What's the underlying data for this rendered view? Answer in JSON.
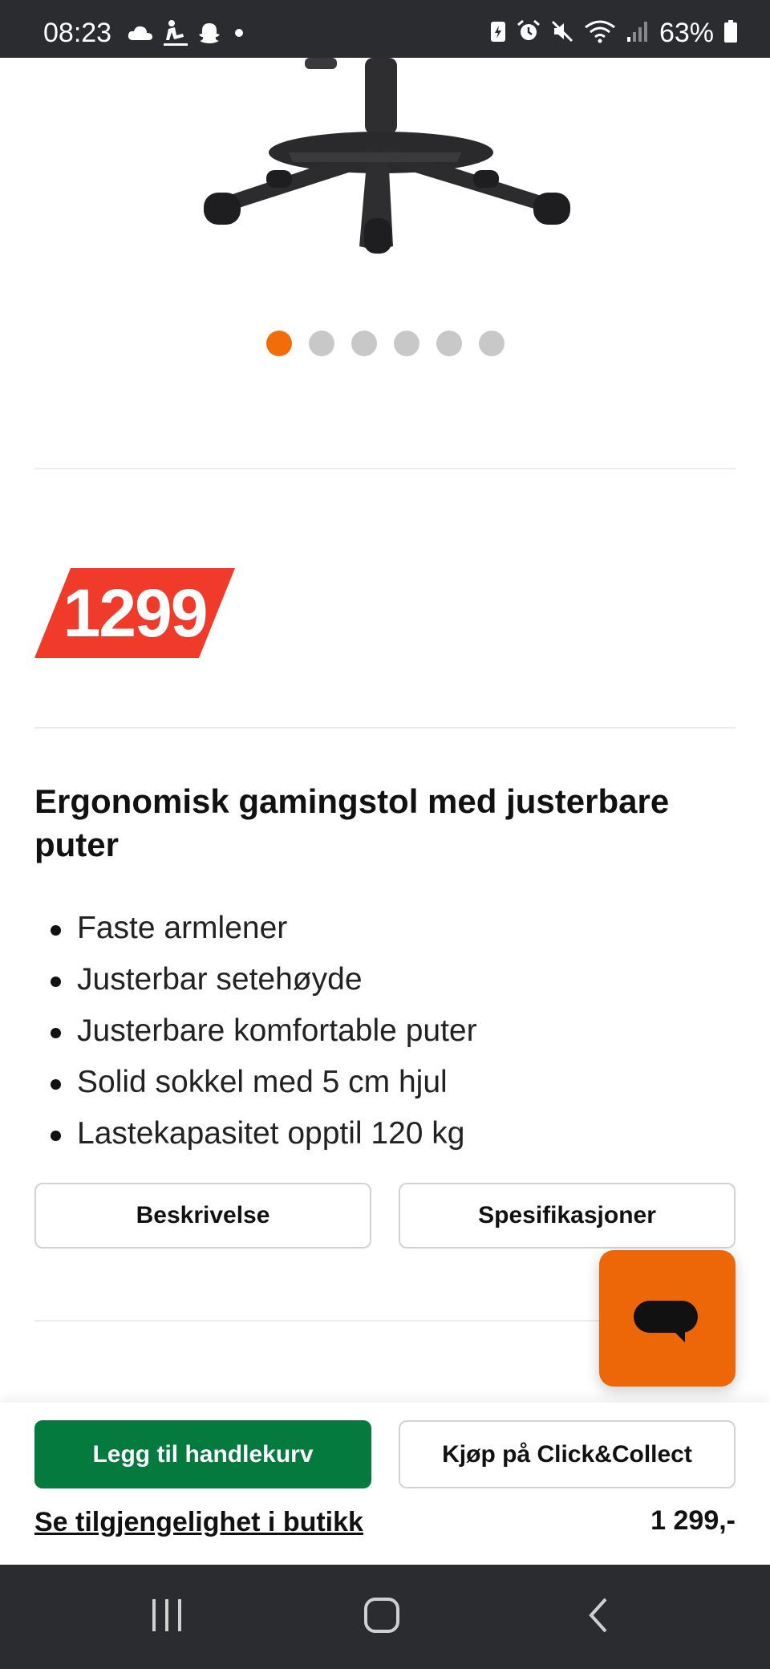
{
  "status_bar": {
    "time": "08:23",
    "battery": "63%",
    "left_icons": [
      "cloud-icon",
      "figure-icon",
      "snapchat-icon",
      "dot-icon"
    ],
    "right_icons": [
      "battery-saver-icon",
      "alarm-icon",
      "mute-icon",
      "wifi-icon",
      "signal-icon",
      "battery-icon"
    ]
  },
  "gallery": {
    "image": "office-chair-base",
    "dots_total": 6,
    "active_dot": 1,
    "accent_color": "#f36c0b"
  },
  "price_badge": {
    "value": "1299",
    "color": "#f03a2a"
  },
  "product": {
    "title": "Ergonomisk gamingstol med justerbare puter",
    "features": [
      "Faste armlener",
      "Justerbar setehøyde",
      "Justerbare komfortable puter",
      "Solid sokkel med 5 cm hjul",
      "Lastekapasitet opptil 120 kg"
    ]
  },
  "tabs": {
    "description": "Beskrivelse",
    "specifications": "Spesifikasjoner"
  },
  "chat": {
    "icon": "chat-bubble-icon",
    "color": "#ed6709"
  },
  "purchase_bar": {
    "add_to_cart": "Legg til handlekurv",
    "click_collect": "Kjøp på Click&Collect",
    "availability": "Se tilgjengelighet i butikk",
    "price": "1 299,-",
    "primary_color": "#047a3e"
  },
  "nav_bar": {
    "icons": [
      "recents-icon",
      "home-icon",
      "back-icon"
    ]
  }
}
